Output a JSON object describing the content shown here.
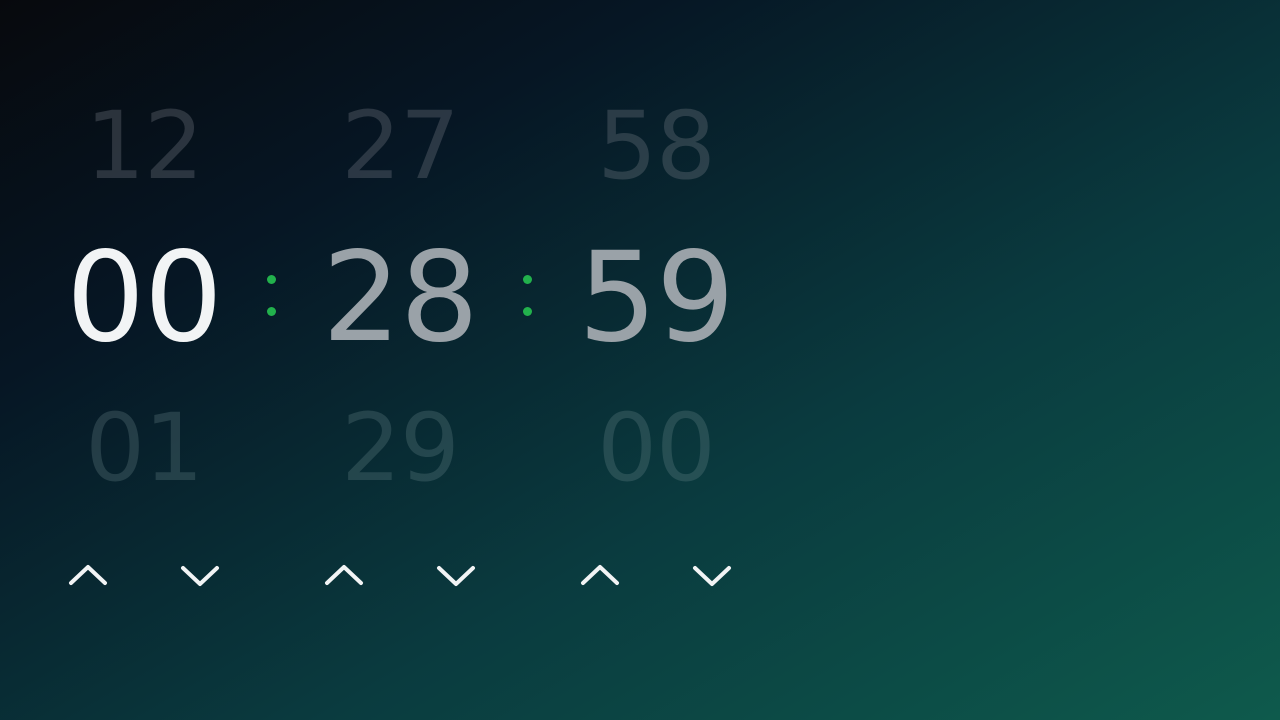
{
  "colors": {
    "accent": "#22b14c",
    "arrow": "#f2f4f5"
  },
  "timer": {
    "hours": {
      "prev": "12",
      "current": "00",
      "next": "01",
      "up_icon": "chevron-up-icon",
      "down_icon": "chevron-down-icon"
    },
    "minutes": {
      "prev": "27",
      "current": "28",
      "next": "29",
      "up_icon": "chevron-up-icon",
      "down_icon": "chevron-down-icon"
    },
    "seconds": {
      "prev": "58",
      "current": "59",
      "next": "00",
      "up_icon": "chevron-up-icon",
      "down_icon": "chevron-down-icon"
    },
    "separator": ":"
  }
}
